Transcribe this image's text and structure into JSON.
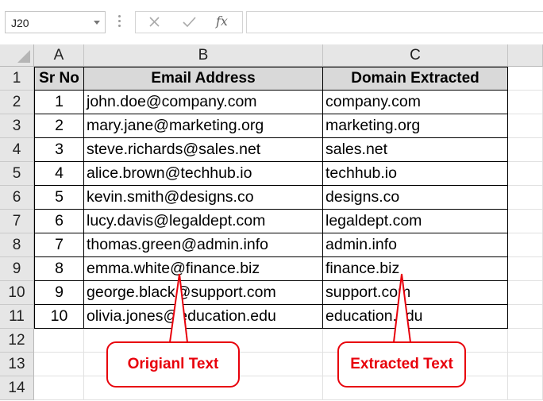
{
  "formula_bar": {
    "name_box": "J20",
    "cancel_icon": "close-icon",
    "enter_icon": "check-icon",
    "function_label": "fx",
    "formula": ""
  },
  "columns": [
    "A",
    "B",
    "C"
  ],
  "rows": [
    "1",
    "2",
    "3",
    "4",
    "5",
    "6",
    "7",
    "8",
    "9",
    "10",
    "11",
    "12",
    "13",
    "14"
  ],
  "table": {
    "headers": [
      "Sr No",
      "Email Address",
      "Domain Extracted"
    ],
    "rows": [
      [
        "1",
        "john.doe@company.com",
        "company.com"
      ],
      [
        "2",
        "mary.jane@marketing.org",
        "marketing.org"
      ],
      [
        "3",
        "steve.richards@sales.net",
        "sales.net"
      ],
      [
        "4",
        "alice.brown@techhub.io",
        "techhub.io"
      ],
      [
        "5",
        "kevin.smith@designs.co",
        "designs.co"
      ],
      [
        "6",
        "lucy.davis@legaldept.com",
        "legaldept.com"
      ],
      [
        "7",
        "thomas.green@admin.info",
        "admin.info"
      ],
      [
        "8",
        "emma.white@finance.biz",
        "finance.biz"
      ],
      [
        "9",
        "george.black@support.com",
        "support.com"
      ],
      [
        "10",
        "olivia.jones@education.edu",
        "education.edu"
      ]
    ]
  },
  "callouts": {
    "original": "Origianl Text",
    "extracted": "Extracted Text"
  },
  "colors": {
    "header_fill": "#d9d9d9",
    "callout": "#e8000b",
    "heading_bg": "#e6e6e6"
  }
}
